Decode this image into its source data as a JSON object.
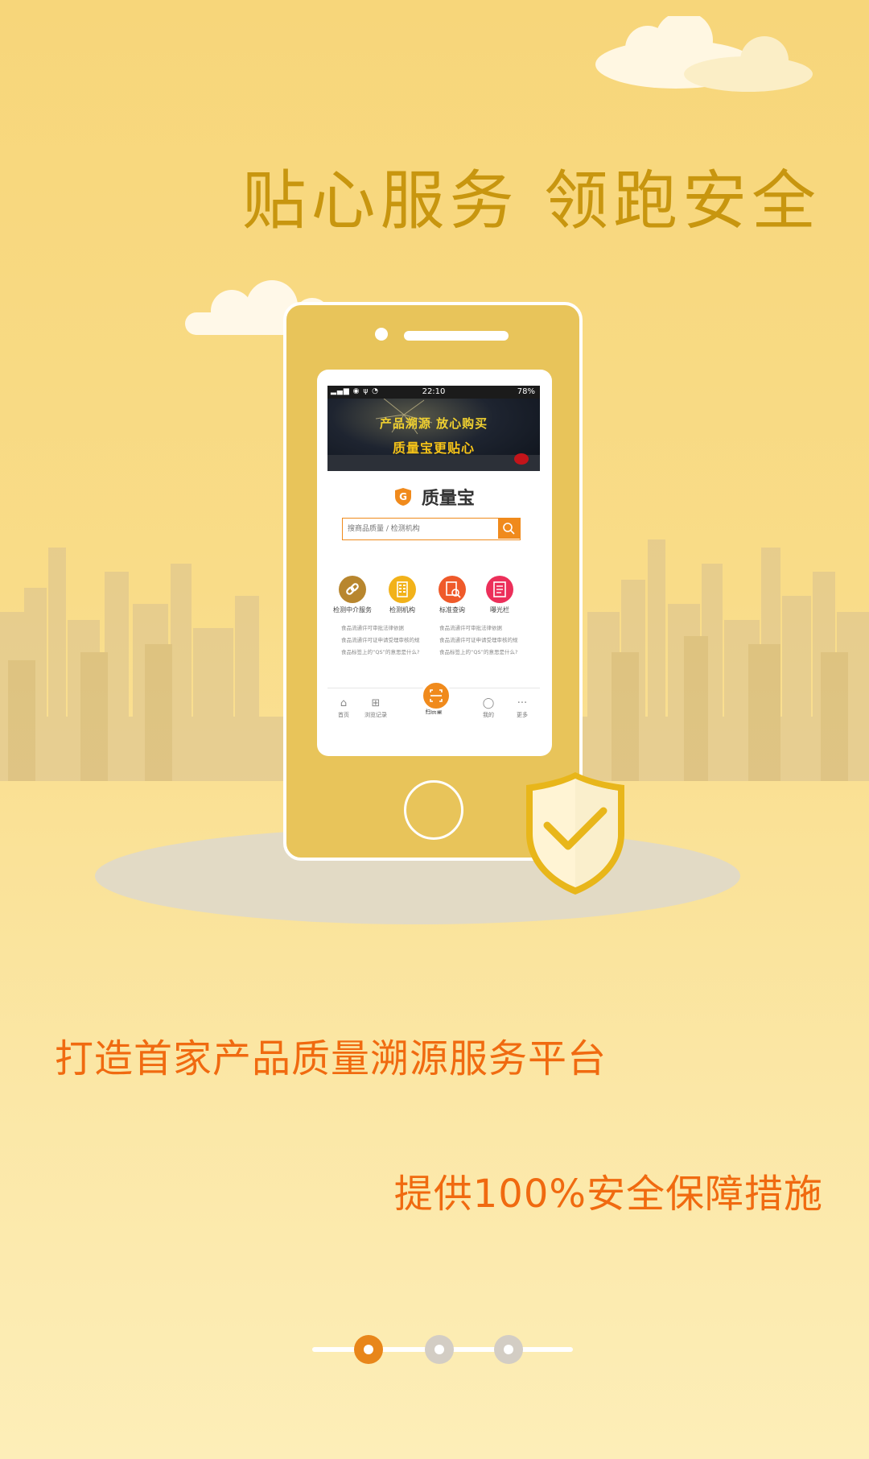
{
  "headline": "贴心服务 领跑安全",
  "phone_app": {
    "status_bar": {
      "time": "22:10",
      "battery": "78%"
    },
    "banner": {
      "line1": "产品溯源  放心购买",
      "line2": "质量宝更贴心"
    },
    "logo_text": "质量宝",
    "search": {
      "placeholder": "搜商品质量 / 检测机构"
    },
    "quick_actions": [
      {
        "label": "检测中介服务",
        "icon": "link-icon",
        "color": "#b8862e"
      },
      {
        "label": "检测机构",
        "icon": "building-icon",
        "color": "#f2b21a"
      },
      {
        "label": "标准查询",
        "icon": "document-search-icon",
        "color": "#ef5a2a"
      },
      {
        "label": "曝光栏",
        "icon": "notepad-icon",
        "color": "#ec2f5a"
      }
    ],
    "news_left": [
      "食品流通许可审批法律依据",
      "食品流通许可证申请受理审核的规",
      "食品标签上的“QS”的意思是什么?"
    ],
    "news_right": [
      "食品流通许可审批法律依据",
      "食品流通许可证申请受理审核的规",
      "食品标签上的“QS”的意思是什么?"
    ],
    "tabs": [
      {
        "label": "首页",
        "icon": "home-icon"
      },
      {
        "label": "浏览记录",
        "icon": "grid-icon"
      },
      {
        "label": "扫质量",
        "icon": "scan-icon"
      },
      {
        "label": "我的",
        "icon": "user-icon"
      },
      {
        "label": "更多",
        "icon": "more-icon"
      }
    ]
  },
  "tagline1": "打造首家产品质量溯源服务平台",
  "tagline2": "提供100%安全保障措施",
  "pager": {
    "count": 3,
    "active_index": 0
  },
  "colors": {
    "accent": "#f06a10",
    "headline": "#c8960f",
    "pager_active": "#e8861a",
    "pager_inactive": "#d3cdc4"
  }
}
